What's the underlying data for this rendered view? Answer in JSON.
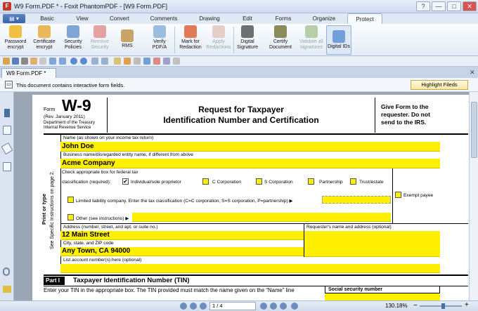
{
  "window": {
    "title": "W9 Form.PDF * - Foxit PhantomPDF - [W9 Form.PDF]",
    "app_icon": "foxit-logo",
    "controls": [
      "?",
      "—",
      "□",
      "✕"
    ]
  },
  "ribbon": {
    "tabs": [
      "Basic",
      "View",
      "Convert",
      "Comments",
      "Drawing",
      "Edit",
      "Forms",
      "Organize",
      "Protect"
    ],
    "active_tab": "Protect",
    "buttons": [
      {
        "label1": "Password",
        "label2": "encrypt",
        "icon": "lock-key-icon"
      },
      {
        "label1": "Certificate",
        "label2": "encrypt",
        "icon": "certificate-icon"
      },
      {
        "label1": "Security",
        "label2": "Policies",
        "icon": "shield-icon"
      },
      {
        "label1": "Remove",
        "label2": "Security",
        "icon": "remove-security-icon",
        "disabled": true
      },
      {
        "label1": "RMS",
        "label2": "",
        "icon": "rms-icon"
      },
      {
        "label1": "Verify",
        "label2": "PDF/A",
        "icon": "verify-icon"
      },
      {
        "label1": "Mark for",
        "label2": "Redaction",
        "icon": "marker-icon"
      },
      {
        "label1": "Apply",
        "label2": "Redactions",
        "icon": "apply-redaction-icon",
        "disabled": true
      },
      {
        "label1": "Digital",
        "label2": "Signature",
        "icon": "pen-icon"
      },
      {
        "label1": "Certify",
        "label2": "Document",
        "icon": "certify-pen-icon"
      },
      {
        "label1": "Validate all",
        "label2": "signatures",
        "icon": "validate-icon",
        "disabled": true
      },
      {
        "label1": "Digital IDs",
        "label2": "",
        "icon": "id-card-icon"
      }
    ]
  },
  "doc_tab": {
    "label": "W9 Form.PDF *"
  },
  "infobar": {
    "text": "This document contains interactive form fields.",
    "highlight_button": "Highlight Fileds"
  },
  "form": {
    "form_label": "Form",
    "form_number": "W-9",
    "rev": "(Rev. January 2011)",
    "dept1": "Department of the Treasury",
    "dept2": "Internal Revenue Service",
    "title1": "Request for Taxpayer",
    "title2": "Identification Number and Certification",
    "give1": "Give Form to the",
    "give2": "requester. Do not",
    "give3": "send to the IRS.",
    "side1": "Print or type",
    "side2": "See Specific Instructions on page 2.",
    "name_label": "Name (as shown on your income tax return)",
    "name_value": "John Doe",
    "business_label": "Business name/disregarded entity name, if different from above",
    "business_value": "Acme Company",
    "check_label1": "Check appropriate box for federal tax",
    "check_label2": "classification (required):",
    "opt_individual": "Individual/sole proprietor",
    "opt_ccorp": "C Corporation",
    "opt_scorp": "S Corporation",
    "opt_partnership": "Partnership",
    "opt_trust": "Trust/estate",
    "exempt": "Exempt payee",
    "llc": "Limited liability company. Enter the tax classification (C=C corporation, S=S corporation, P=partnership) ▶",
    "other": "Other (see instructions) ▶",
    "address_label": "Address (number, street, and apt. or suite no.)",
    "address_value": "12 Main Street",
    "requester_label": "Requester's name and address (optional)",
    "city_label": "City, state, and ZIP code",
    "city_value": "Any Town, CA 94000",
    "account_label": "List account number(s) here (optional)",
    "part1": "Part I",
    "part1_title": "Taxpayer Identification Number (TIN)",
    "tin_text": "Enter your TIN in the appropriate box. The TIN provided must match the name given on the “Name” line",
    "ssn_label": "Social security number",
    "individual_checked": true
  },
  "status": {
    "page": "1 / 4",
    "zoom": "130.18%"
  }
}
